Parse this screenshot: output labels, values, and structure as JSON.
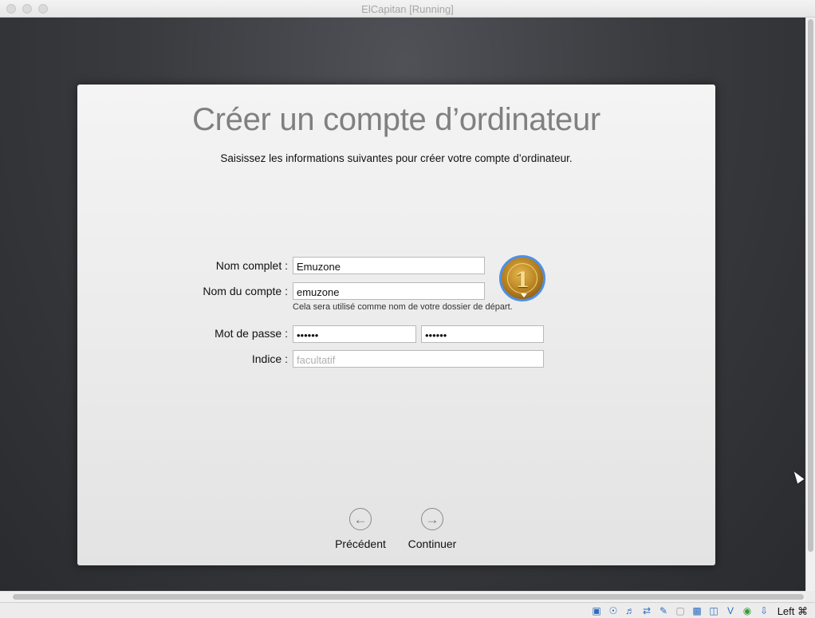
{
  "window": {
    "title": "ElCapitan [Running]"
  },
  "setup": {
    "heading": "Créer un compte d’ordinateur",
    "subheading": "Saisissez les informations suivantes pour créer votre compte d’ordinateur.",
    "full_name_label": "Nom complet :",
    "full_name_value": "Emuzone",
    "account_name_label": "Nom du compte :",
    "account_name_value": "emuzone",
    "account_name_help": "Cela sera utilisé comme nom de votre dossier de départ.",
    "password_label": "Mot de passe :",
    "password_value": "••••••",
    "verify_value": "••••••",
    "hint_label": "Indice :",
    "hint_placeholder": "facultatif",
    "avatar_number": "1",
    "back_label": "Précédent",
    "continue_label": "Continuer"
  },
  "statusbar": {
    "icons": [
      "hard-disk-icon",
      "optical-disk-icon",
      "audio-icon",
      "network-icon",
      "usb-icon",
      "shared-folder-icon",
      "display-icon",
      "video-capture-icon",
      "virtualization-icon",
      "globe-icon",
      "download-icon"
    ],
    "host_key": "Left ⌘"
  },
  "colors": {
    "desktop": "#3a3b3f",
    "avatar_ring": "#4f8fe6",
    "status_icon": "#2c6bbf"
  }
}
